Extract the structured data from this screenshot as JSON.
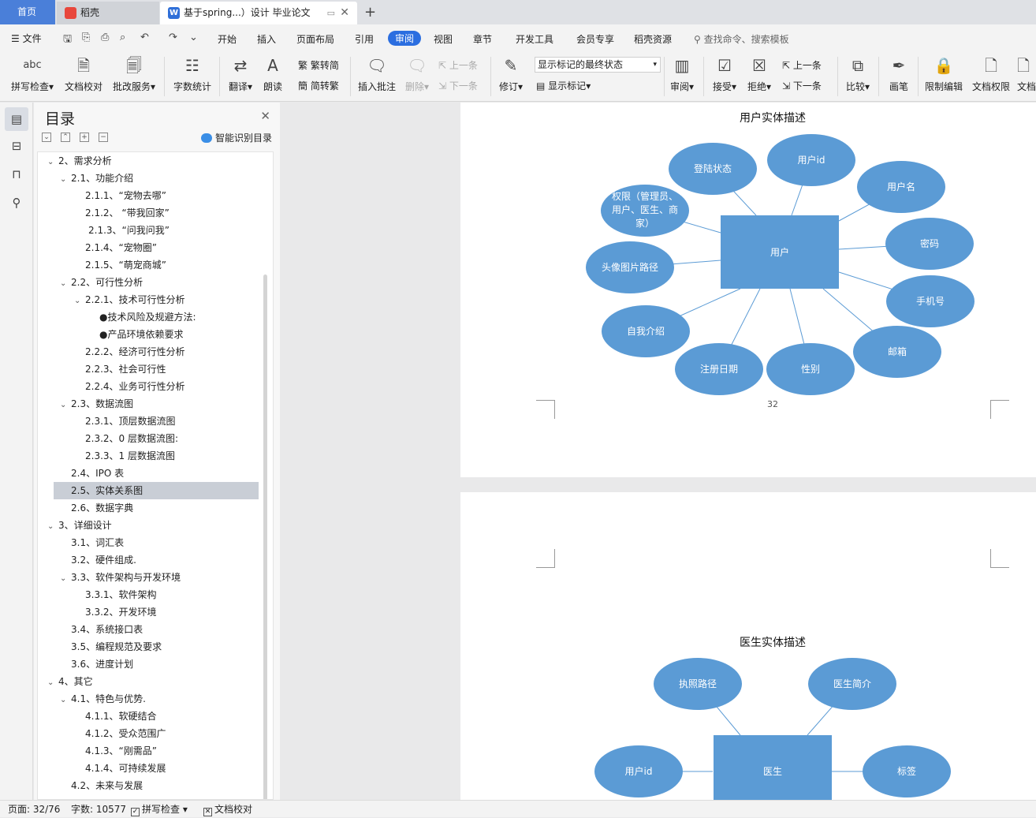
{
  "tabs": {
    "home": "首页",
    "docer": "稻壳",
    "doc": "基于spring...）设计 毕业论文"
  },
  "menu": {
    "file": "文件",
    "items": [
      "开始",
      "插入",
      "页面布局",
      "引用",
      "审阅",
      "视图",
      "章节",
      "开发工具",
      "会员专享",
      "稻壳资源"
    ],
    "active": "审阅",
    "search_placeholder": "查找命令、搜索模板"
  },
  "ribbon": {
    "spell_check": "拼写检查",
    "doc_proof": "文档校对",
    "batch_service": "批改服务",
    "word_count": "字数统计",
    "translate": "翻译",
    "read_aloud": "朗读",
    "trad_simp": "繁转简",
    "simp_trad": "简转繁",
    "insert_comment": "插入批注",
    "delete": "删除",
    "prev": "上一条",
    "next": "下一条",
    "revise": "修订",
    "markup_state": "显示标记的最终状态",
    "show_markup": "显示标记",
    "review": "审阅",
    "accept": "接受",
    "reject": "拒绝",
    "prev2": "上一条",
    "next2": "下一条",
    "compare": "比较",
    "pen": "画笔",
    "restrict_edit": "限制编辑",
    "doc_permission": "文档权限",
    "doc_more": "文档"
  },
  "toc": {
    "title": "目录",
    "smart": "智能识别目录",
    "items": [
      {
        "label": "2、需求分析",
        "level": 0,
        "chev": true
      },
      {
        "label": "2.1、功能介绍",
        "level": 1,
        "chev": true
      },
      {
        "label": "2.1.1、“宠物去哪”",
        "level": 2
      },
      {
        "label": "2.1.2、 “带我回家”",
        "level": 2
      },
      {
        "label": "2.1.3、“问我问我”",
        "level": 2,
        "extra": 4
      },
      {
        "label": "2.1.4、“宠物圈”",
        "level": 2
      },
      {
        "label": "2.1.5、“萌宠商城”",
        "level": 2
      },
      {
        "label": "2.2、可行性分析",
        "level": 1,
        "chev": true
      },
      {
        "label": "2.2.1、技术可行性分析",
        "level": 2,
        "chev": true
      },
      {
        "label": "●技术风险及规避方法:",
        "level": 3
      },
      {
        "label": "●产品环境依赖要求",
        "level": 3
      },
      {
        "label": "2.2.2、经济可行性分析",
        "level": 2
      },
      {
        "label": "2.2.3、社会可行性",
        "level": 2
      },
      {
        "label": "2.2.4、业务可行性分析",
        "level": 2
      },
      {
        "label": "2.3、数据流图",
        "level": 1,
        "chev": true
      },
      {
        "label": "2.3.1、顶层数据流图",
        "level": 2
      },
      {
        "label": "2.3.2、0 层数据流图:",
        "level": 2
      },
      {
        "label": "2.3.3、1 层数据流图",
        "level": 2
      },
      {
        "label": "2.4、IPO 表",
        "level": 1
      },
      {
        "label": "2.5、实体关系图",
        "level": 1,
        "selected": true
      },
      {
        "label": "2.6、数据字典",
        "level": 1
      },
      {
        "label": "3、详细设计",
        "level": 0,
        "chev": true
      },
      {
        "label": "3.1、词汇表",
        "level": 1
      },
      {
        "label": "3.2、硬件组成.",
        "level": 1
      },
      {
        "label": "3.3、软件架构与开发环境",
        "level": 1,
        "chev": true
      },
      {
        "label": "3.3.1、软件架构",
        "level": 2
      },
      {
        "label": "3.3.2、开发环境",
        "level": 2
      },
      {
        "label": "3.4、系统接口表",
        "level": 1
      },
      {
        "label": "3.5、编程规范及要求",
        "level": 1
      },
      {
        "label": "3.6、进度计划",
        "level": 1
      },
      {
        "label": "4、其它",
        "level": 0,
        "chev": true
      },
      {
        "label": "4.1、特色与优势.",
        "level": 1,
        "chev": true
      },
      {
        "label": "4.1.1、软硬结合",
        "level": 2
      },
      {
        "label": "4.1.2、受众范围广",
        "level": 2
      },
      {
        "label": "4.1.3、“刚需品”",
        "level": 2
      },
      {
        "label": "4.1.4、可持续发展",
        "level": 2
      },
      {
        "label": "4.2、未来与发展",
        "level": 1
      }
    ]
  },
  "page1": {
    "title": "用户实体描述",
    "entity": "用户",
    "attributes": [
      "登陆状态",
      "用户id",
      "用户名",
      "权限（管理员、",
      "用户、医生、商",
      "家）",
      "密码",
      "头像图片路径",
      "手机号",
      "自我介绍",
      "邮箱",
      "注册日期",
      "性别"
    ],
    "page_number": "32"
  },
  "page2": {
    "title": "医生实体描述",
    "entity": "医生",
    "attributes": [
      "执照路径",
      "医生简介",
      "用户id",
      "标签"
    ]
  },
  "status": {
    "page": "页面: 32/76",
    "words": "字数: 10577",
    "spell": "拼写检查",
    "proof": "文档校对"
  },
  "colors": {
    "ellipse": "#5b9bd5",
    "accent": "#2b6ee0"
  }
}
